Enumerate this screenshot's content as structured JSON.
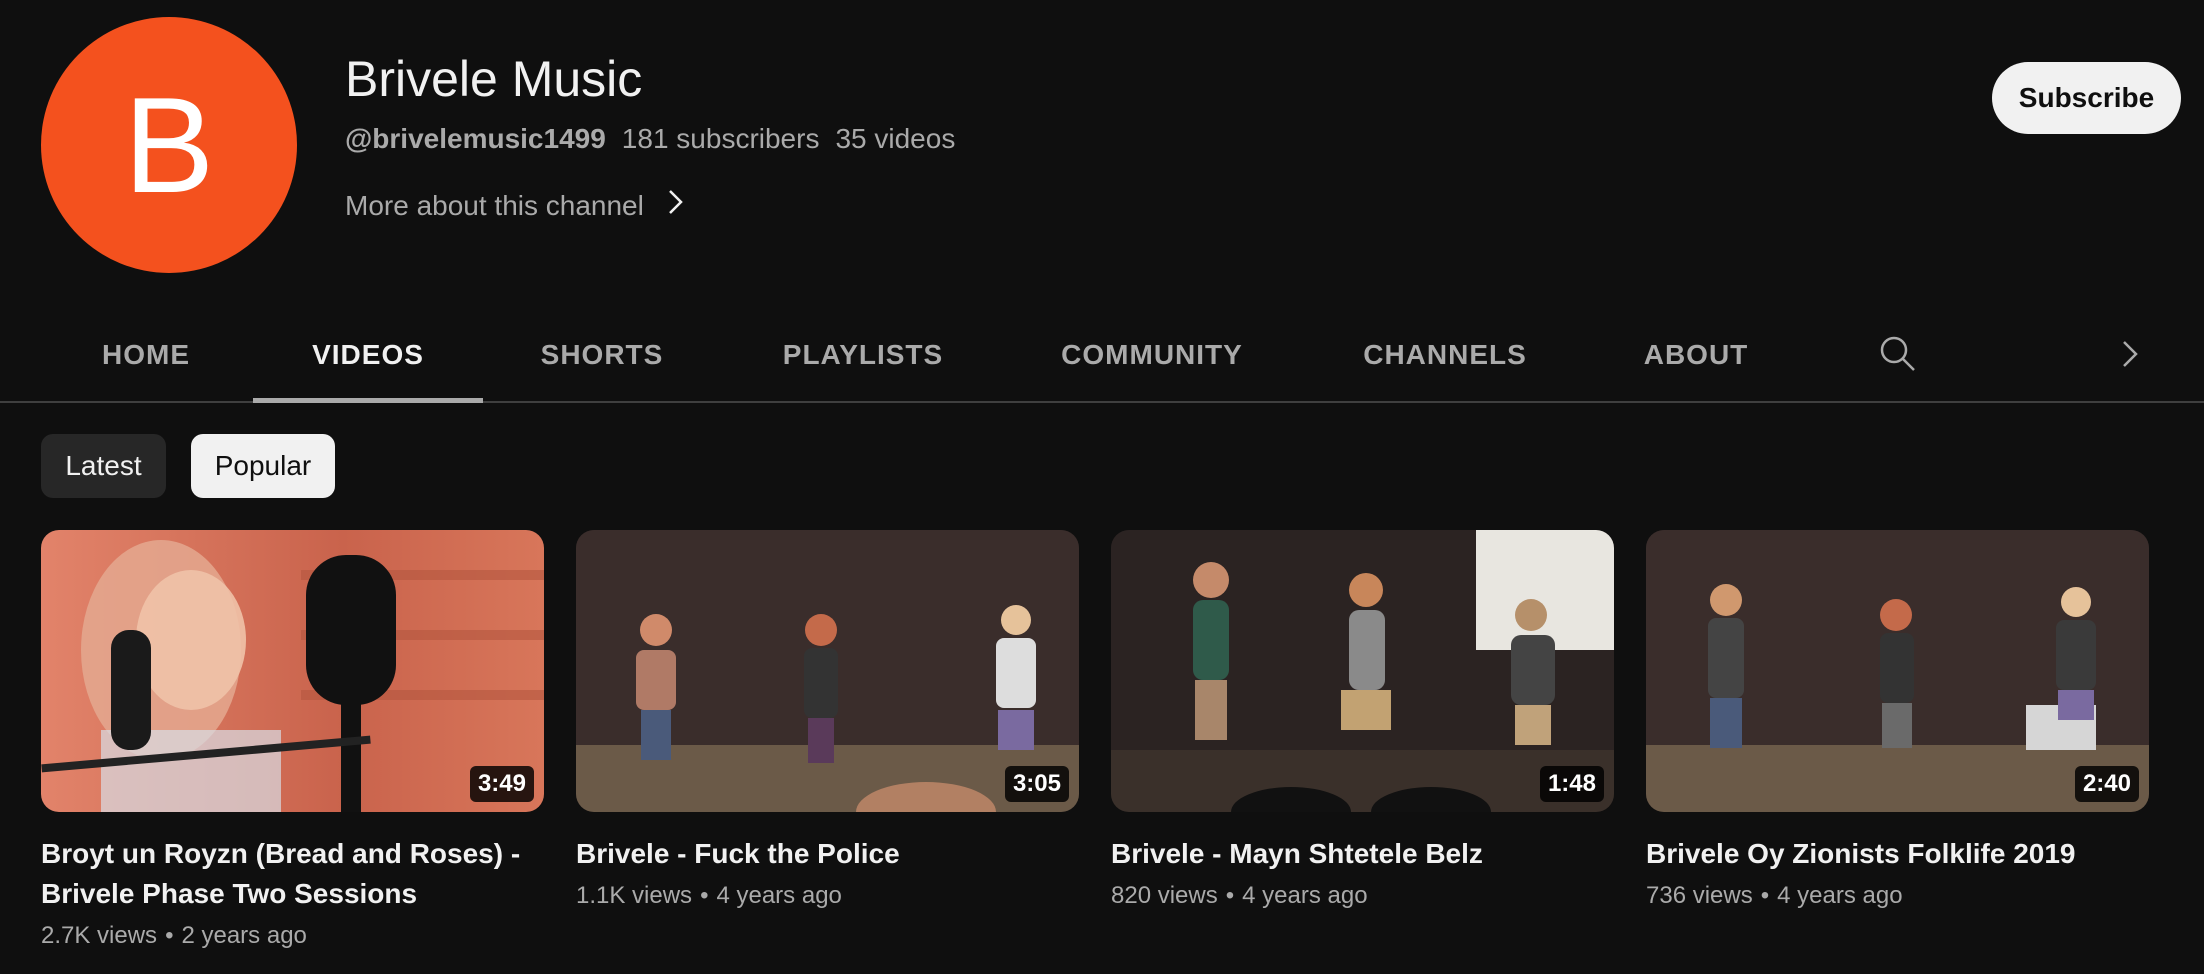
{
  "channel": {
    "avatar_letter": "B",
    "name": "Brivele Music",
    "handle": "@brivelemusic1499",
    "subscribers": "181 subscribers",
    "videos_count": "35 videos",
    "more_about": "More about this channel",
    "subscribe_label": "Subscribe",
    "avatar_color": "#f4511e"
  },
  "tabs": [
    {
      "label": "HOME"
    },
    {
      "label": "VIDEOS",
      "active": true
    },
    {
      "label": "SHORTS"
    },
    {
      "label": "PLAYLISTS"
    },
    {
      "label": "COMMUNITY"
    },
    {
      "label": "CHANNELS"
    },
    {
      "label": "ABOUT"
    }
  ],
  "tab_icons": [
    "search-icon",
    "chevron-right-icon"
  ],
  "filters": {
    "latest": "Latest",
    "popular": "Popular",
    "selected": "Popular"
  },
  "videos": [
    {
      "title": "Broyt un Royzn (Bread and Roses) - Brivele Phase Two Sessions",
      "duration": "3:49",
      "views": "2.7K views",
      "age": "2 years ago"
    },
    {
      "title": "Brivele - Fuck the Police",
      "duration": "3:05",
      "views": "1.1K views",
      "age": "4 years ago"
    },
    {
      "title": "Brivele - Mayn Shtetele Belz",
      "duration": "1:48",
      "views": "820 views",
      "age": "4 years ago"
    },
    {
      "title": "Brivele Oy Zionists Folklife 2019",
      "duration": "2:40",
      "views": "736 views",
      "age": "4 years ago"
    }
  ],
  "separator": "•"
}
